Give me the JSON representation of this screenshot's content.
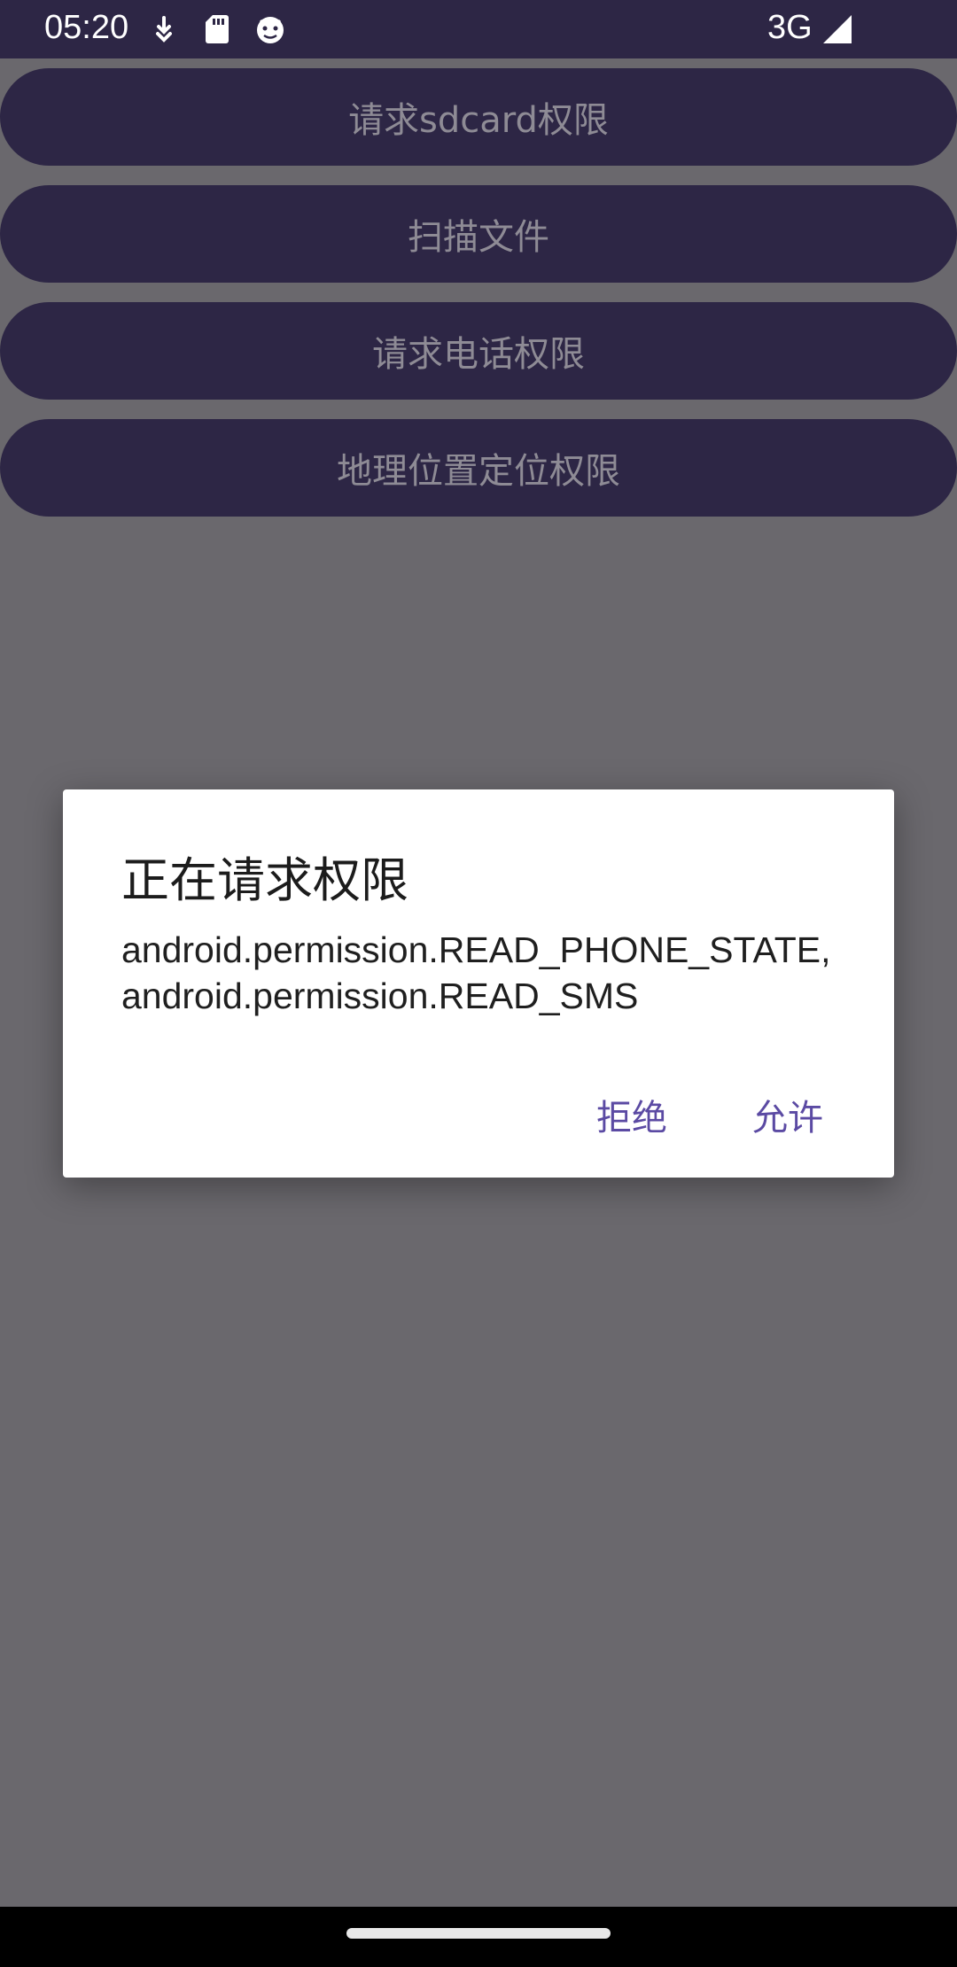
{
  "status_bar": {
    "time": "05:20",
    "left_icons": [
      "download-icon",
      "sdcard-icon",
      "android-icon"
    ],
    "network": "3G",
    "right_icons": [
      "signal-icon"
    ]
  },
  "buttons": [
    {
      "label": "请求sdcard权限"
    },
    {
      "label": "扫描文件"
    },
    {
      "label": "请求电话权限"
    },
    {
      "label": "地理位置定位权限"
    }
  ],
  "dialog": {
    "title": "正在请求权限",
    "message": "android.permission.READ_PHONE_STATE,android.permission.READ_SMS",
    "deny_label": "拒绝",
    "allow_label": "允许"
  },
  "colors": {
    "primary": "#2d2645",
    "scrim": "#6a686d",
    "accent": "#5b4aa3"
  }
}
